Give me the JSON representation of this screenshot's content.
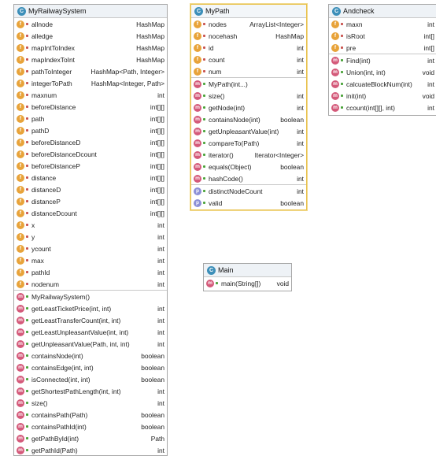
{
  "classes": {
    "railway": {
      "name": "MyRailwaySystem",
      "fields": [
        {
          "name": "allnode",
          "type": "HashMap"
        },
        {
          "name": "alledge",
          "type": "HashMap"
        },
        {
          "name": "mapIntToIndex",
          "type": "HashMap"
        },
        {
          "name": "mapIndexToInt",
          "type": "HashMap"
        },
        {
          "name": "pathToInteger",
          "type": "HashMap<Path, Integer>"
        },
        {
          "name": "integerToPath",
          "type": "HashMap<Integer, Path>"
        },
        {
          "name": "maxnum",
          "type": "int"
        },
        {
          "name": "beforeDistance",
          "type": "int[][]"
        },
        {
          "name": "path",
          "type": "int[][]"
        },
        {
          "name": "pathD",
          "type": "int[][]"
        },
        {
          "name": "beforeDistanceD",
          "type": "int[][]"
        },
        {
          "name": "beforeDistanceDcount",
          "type": "int[][]"
        },
        {
          "name": "beforeDistanceP",
          "type": "int[][]"
        },
        {
          "name": "distance",
          "type": "int[][]"
        },
        {
          "name": "distanceD",
          "type": "int[][]"
        },
        {
          "name": "distanceP",
          "type": "int[][]"
        },
        {
          "name": "distanceDcount",
          "type": "int[][]"
        },
        {
          "name": "x",
          "type": "int"
        },
        {
          "name": "y",
          "type": "int"
        },
        {
          "name": "ycount",
          "type": "int"
        },
        {
          "name": "max",
          "type": "int"
        },
        {
          "name": "pathId",
          "type": "int"
        },
        {
          "name": "nodenum",
          "type": "int"
        }
      ],
      "methods": [
        {
          "name": "MyRailwaySystem()",
          "type": ""
        },
        {
          "name": "getLeastTicketPrice(int, int)",
          "type": "int"
        },
        {
          "name": "getLeastTransferCount(int, int)",
          "type": "int"
        },
        {
          "name": "getLeastUnpleasantValue(int, int)",
          "type": "int"
        },
        {
          "name": "getUnpleasantValue(Path, int, int)",
          "type": "int"
        },
        {
          "name": "containsNode(int)",
          "type": "boolean"
        },
        {
          "name": "containsEdge(int, int)",
          "type": "boolean"
        },
        {
          "name": "isConnected(int, int)",
          "type": "boolean"
        },
        {
          "name": "getShortestPathLength(int, int)",
          "type": "int"
        },
        {
          "name": "size()",
          "type": "int"
        },
        {
          "name": "containsPath(Path)",
          "type": "boolean"
        },
        {
          "name": "containsPathId(int)",
          "type": "boolean"
        },
        {
          "name": "getPathById(int)",
          "type": "Path"
        },
        {
          "name": "getPathId(Path)",
          "type": "int"
        }
      ]
    },
    "mypath": {
      "name": "MyPath",
      "fields": [
        {
          "name": "nodes",
          "type": "ArrayList<Integer>"
        },
        {
          "name": "nocehash",
          "type": "HashMap"
        },
        {
          "name": "id",
          "type": "int"
        },
        {
          "name": "count",
          "type": "int"
        },
        {
          "name": "num",
          "type": "int"
        }
      ],
      "methods": [
        {
          "name": "MyPath(int...)",
          "type": ""
        },
        {
          "name": "size()",
          "type": "int"
        },
        {
          "name": "getNode(int)",
          "type": "int"
        },
        {
          "name": "containsNode(int)",
          "type": "boolean"
        },
        {
          "name": "getUnpleasantValue(int)",
          "type": "int"
        },
        {
          "name": "compareTo(Path)",
          "type": "int"
        },
        {
          "name": "iterator()",
          "type": "Iterator<Integer>"
        },
        {
          "name": "equals(Object)",
          "type": "boolean"
        },
        {
          "name": "hashCode()",
          "type": "int"
        }
      ],
      "properties": [
        {
          "name": "distinctNodeCount",
          "type": "int"
        },
        {
          "name": "valid",
          "type": "boolean"
        }
      ]
    },
    "andcheck": {
      "name": "Andcheck",
      "fields": [
        {
          "name": "maxn",
          "type": "int"
        },
        {
          "name": "isRoot",
          "type": "int[]"
        },
        {
          "name": "pre",
          "type": "int[]"
        }
      ],
      "methods": [
        {
          "name": "Find(int)",
          "type": "int"
        },
        {
          "name": "Union(int, int)",
          "type": "void"
        },
        {
          "name": "calcuateBlockNum(int)",
          "type": "int"
        },
        {
          "name": "init(int)",
          "type": "void"
        },
        {
          "name": "ccount(int[][], int)",
          "type": "int"
        }
      ]
    },
    "main": {
      "name": "Main",
      "fields": [],
      "methods": [
        {
          "name": "main(String[])",
          "type": "void"
        }
      ]
    }
  },
  "colors": {
    "field_icon": "#e8a33a",
    "method_icon": "#d45a7a",
    "property_icon": "#8c8fd6",
    "class_icon": "#3d8fb9",
    "selected_border": "#e8c04a"
  },
  "icons": {
    "class": "C",
    "field": "f",
    "method": "m",
    "property": "p"
  }
}
